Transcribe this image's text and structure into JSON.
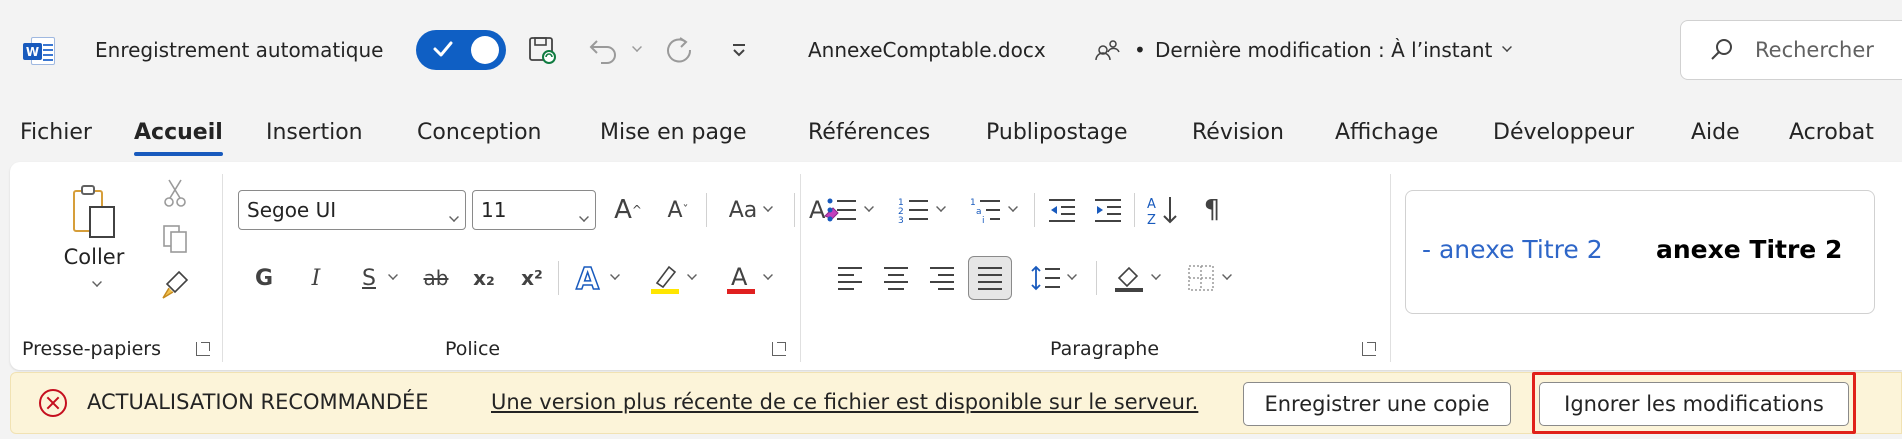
{
  "titlebar": {
    "autosave_label": "Enregistrement automatique",
    "document_name": "AnnexeComptable.docx",
    "bullet": "•",
    "last_modified": "Dernière modification : À l’instant",
    "search_placeholder": "Rechercher"
  },
  "tabs": [
    "Fichier",
    "Accueil",
    "Insertion",
    "Conception",
    "Mise en page",
    "Références",
    "Publipostage",
    "Révision",
    "Affichage",
    "Développeur",
    "Aide",
    "Acrobat"
  ],
  "active_tab": "Accueil",
  "ribbon": {
    "clipboard": {
      "paste_label": "Coller",
      "group_label": "Presse-papiers"
    },
    "font": {
      "font_name": "Segoe UI",
      "font_size": "11",
      "group_label": "Police",
      "bold": "G",
      "italic": "I",
      "underline": "S",
      "strike": "ab",
      "subscript": "x₂",
      "superscript": "x²",
      "grow": "A",
      "shrink": "A",
      "case": "Aa"
    },
    "paragraph": {
      "group_label": "Paragraphe",
      "pilcrow": "¶"
    },
    "styles": {
      "style1": "- anexe Titre 2",
      "style2": "anexe Titre 2"
    }
  },
  "message_bar": {
    "title": "ACTUALISATION RECOMMANDÉE",
    "message": "Une version plus récente de ce fichier est disponible sur le serveur.",
    "save_copy_button": "Enregistrer une copie",
    "discard_button": "Ignorer les modifications"
  },
  "colors": {
    "accent": "#185abd",
    "toggle": "#0f5fc4",
    "message_bar_bg": "#fcf4d9",
    "error": "#c50f1f",
    "highlight_yellow": "#ffe600",
    "font_red": "#e02020"
  }
}
